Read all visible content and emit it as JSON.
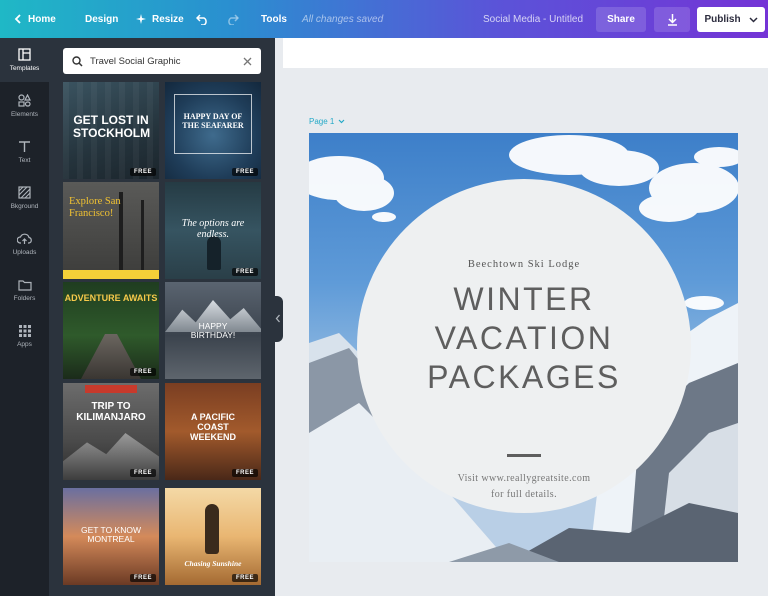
{
  "topbar": {
    "home_label": "Home",
    "design_label": "Design",
    "resize_label": "Resize",
    "tools_label": "Tools",
    "autosave_status": "All changes saved",
    "document_title": "Social Media - Untitled",
    "share_label": "Share",
    "publish_label": "Publish"
  },
  "rail": {
    "items": [
      {
        "label": "Templates",
        "icon": "templates-icon"
      },
      {
        "label": "Elements",
        "icon": "elements-icon"
      },
      {
        "label": "Text",
        "icon": "text-icon"
      },
      {
        "label": "Bkground",
        "icon": "background-icon"
      },
      {
        "label": "Uploads",
        "icon": "upload-icon"
      },
      {
        "label": "Folders",
        "icon": "folder-icon"
      },
      {
        "label": "Apps",
        "icon": "apps-icon"
      }
    ]
  },
  "panel": {
    "search_value": "Travel Social Graphic",
    "free_badge": "FREE",
    "templates": [
      {
        "title": "GET LOST IN STOCKHOLM",
        "sub": ""
      },
      {
        "title": "HAPPY DAY OF THE SEAFARER",
        "sub": ""
      },
      {
        "title": "Explore San Francisco!",
        "sub": ""
      },
      {
        "title": "The options are endless.",
        "sub": ""
      },
      {
        "title": "ADVENTURE AWAITS",
        "sub": ""
      },
      {
        "title": "HAPPY BIRTHDAY!",
        "sub": ""
      },
      {
        "title": "TRIP TO KILIMANJARO",
        "sub": ""
      },
      {
        "title": "A PACIFIC COAST WEEKEND",
        "sub": ""
      },
      {
        "title": "GET TO KNOW MONTREAL",
        "sub": ""
      },
      {
        "title": "Chasing Sunshine",
        "sub": ""
      }
    ]
  },
  "canvas": {
    "page_label": "Page 1",
    "lodge": "Beechtown Ski Lodge",
    "headline_1": "WINTER",
    "headline_2": "VACATION",
    "headline_3": "PACKAGES",
    "visit_1": "Visit www.reallygreatsite.com",
    "visit_2": "for full details."
  }
}
